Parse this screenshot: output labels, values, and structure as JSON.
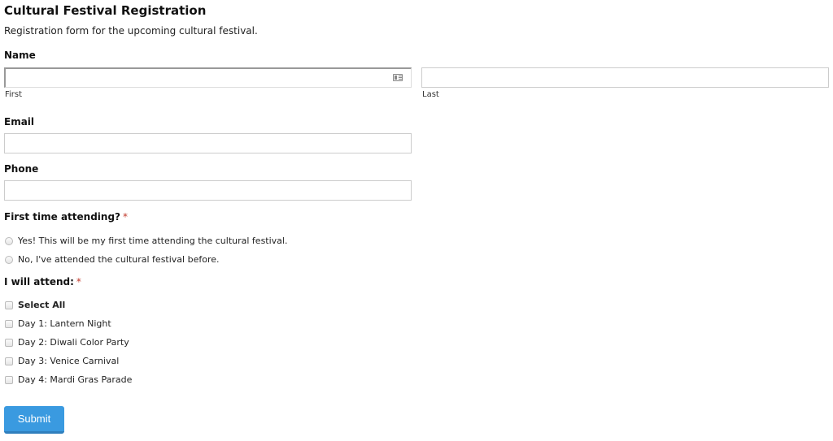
{
  "form": {
    "title": "Cultural Festival Registration",
    "description": "Registration form for the upcoming cultural festival."
  },
  "name": {
    "label": "Name",
    "first": {
      "value": "",
      "sublabel": "First"
    },
    "last": {
      "value": "",
      "sublabel": "Last"
    },
    "autofill_icon": "contact-card-icon"
  },
  "email": {
    "label": "Email",
    "value": ""
  },
  "phone": {
    "label": "Phone",
    "value": ""
  },
  "first_time": {
    "label": "First time attending?",
    "required_mark": "*",
    "options": [
      {
        "label": "Yes! This will be my first time attending the cultural festival.",
        "checked": false
      },
      {
        "label": "No, I've attended the cultural festival before.",
        "checked": false
      }
    ]
  },
  "attend": {
    "label": "I will attend:",
    "required_mark": "*",
    "select_all": {
      "label": "Select All",
      "checked": false
    },
    "options": [
      {
        "label": "Day 1: Lantern Night",
        "checked": false
      },
      {
        "label": "Day 2: Diwali Color Party",
        "checked": false
      },
      {
        "label": "Day 3: Venice Carnival",
        "checked": false
      },
      {
        "label": "Day 4: Mardi Gras Parade",
        "checked": false
      }
    ]
  },
  "submit": {
    "label": "Submit",
    "color": "#3a9ae0"
  }
}
